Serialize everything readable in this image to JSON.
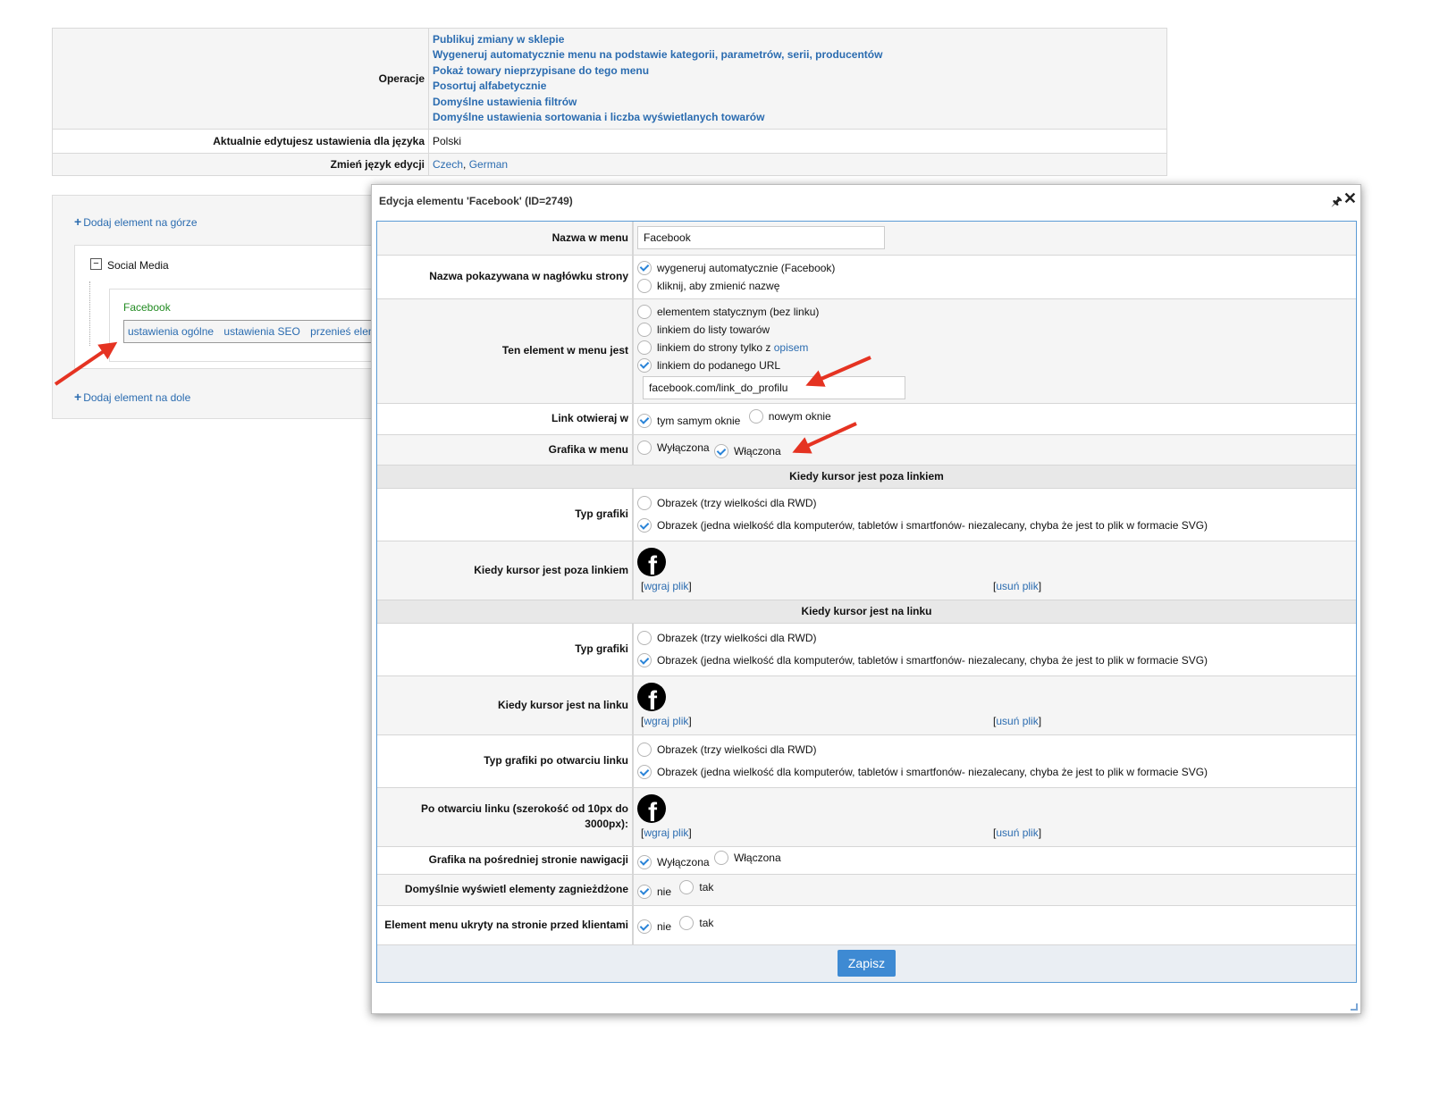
{
  "top": {
    "ops_label": "Operacje",
    "ops": [
      "Publikuj zmiany w sklepie",
      "Wygeneruj automatycznie menu na podstawie kategorii, parametrów, serii, producentów",
      "Pokaż towary nieprzypisane do tego menu",
      "Posortuj alfabetycznie",
      "Domyślne ustawienia filtrów",
      "Domyślne ustawienia sortowania i liczba wyświetlanych towarów"
    ],
    "lang_label": "Aktualnie edytujesz ustawienia dla języka",
    "lang_value": "Polski",
    "change_label": "Zmień język edycji",
    "change_langs": [
      "Czech",
      "German"
    ],
    "change_sep": ", "
  },
  "tree": {
    "add_top": "Dodaj element na górze",
    "add_bottom": "Dodaj element na dole",
    "collapse_symbol": "−",
    "group_label": "Social Media",
    "item_label": "Facebook",
    "actions": [
      "ustawienia ogólne",
      "ustawienia SEO",
      "przenieś element"
    ]
  },
  "dialog": {
    "title": "Edycja elementu 'Facebook' (ID=2749)",
    "pin_icon": "pin-icon",
    "close_icon": "close-icon",
    "name_label": "Nazwa w menu",
    "name_value": "Facebook",
    "header_label": "Nazwa pokazywana w nagłówku strony",
    "header_opts": [
      "wygeneruj automatycznie (Facebook)",
      "kliknij, aby zmienić nazwę"
    ],
    "type_label": "Ten element w menu jest",
    "type_opts": [
      "elementem statycznym (bez linku)",
      "linkiem do listy towarów"
    ],
    "type_opt3_text": "linkiem do strony tylko z ",
    "type_opt3_link": "opisem",
    "type_opt4": "linkiem do podanego URL",
    "url_value": "facebook.com/link_do_profilu",
    "open_label": "Link otwieraj w",
    "open_same": "tym samym oknie",
    "open_new": "nowym oknie",
    "graphic_label": "Grafika w menu",
    "off": "Wyłączona",
    "on": "Włączona",
    "section1": "Kiedy kursor jest poza linkiem",
    "section2": "Kiedy kursor jest na linku",
    "type_graphic_label": "Typ grafiki",
    "type_graphic_label_open": "Typ grafiki po otwarciu linku",
    "opt_rwd": "Obrazek (trzy wielkości dla RWD)",
    "opt_one": "Obrazek (jedna wielkość dla komputerów, tabletów i smartfonów- niezalecany, chyba że jest to plik w formacie SVG)",
    "outside_label": "Kiedy kursor jest poza linkiem",
    "on_link_label": "Kiedy kursor jest na linku",
    "after_open_label": "Po otwarciu linku (szerokość od 10px do 3000px):",
    "icon_glyph": "f",
    "upload": "wgraj plik",
    "remove": "usuń plik",
    "bracket_open": "[",
    "bracket_close": "]",
    "intermediate_label": "Grafika na pośredniej stronie nawigacji",
    "nested_label": "Domyślnie wyświetl elementy zagnieżdżone",
    "hidden_label": "Element menu ukryty na stronie przed klientami",
    "no": "nie",
    "yes": "tak",
    "save": "Zapisz"
  },
  "colors": {
    "link": "#2b6cb0",
    "accent": "#3e8ad3",
    "arrow": "#e53322",
    "tree_item": "#228b22"
  }
}
